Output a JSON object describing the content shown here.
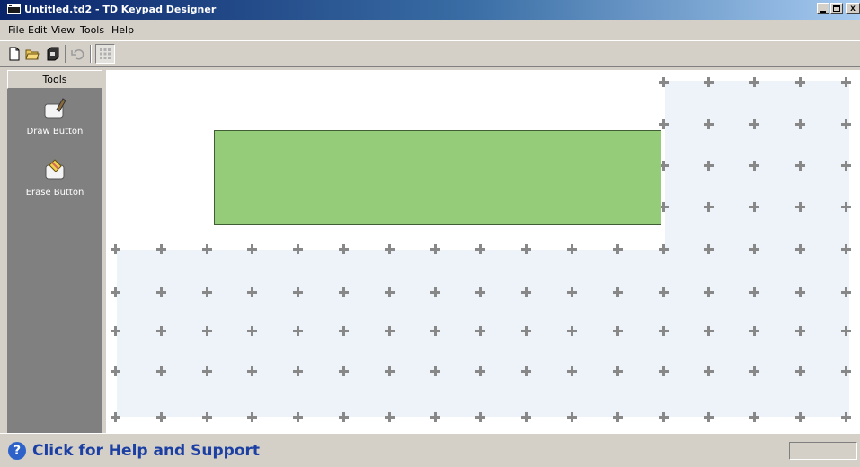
{
  "window": {
    "title": "Untitled.td2 - TD Keypad Designer"
  },
  "menu": [
    "File",
    "Edit",
    "View",
    "Tools",
    "Help"
  ],
  "toolbar": {
    "icons": [
      "new-file-icon",
      "open-folder-icon",
      "save-icon",
      "undo-icon",
      "grid-icon"
    ]
  },
  "tools": {
    "header": "Tools",
    "items": [
      {
        "label": "Draw Button",
        "icon": "draw-button-icon"
      },
      {
        "label": "Erase Button",
        "icon": "erase-button-icon"
      }
    ]
  },
  "canvas": {
    "button_color": "#94cc7a",
    "tile_color": "#eef2f9"
  },
  "status": {
    "help_text": "Click for Help and Support",
    "help_icon": "?"
  }
}
